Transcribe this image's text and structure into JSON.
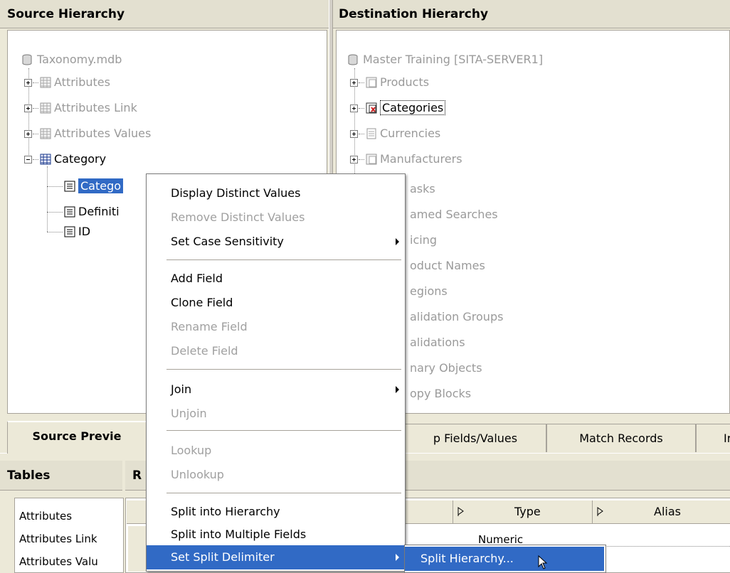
{
  "source": {
    "header": "Source Hierarchy",
    "tree": {
      "root": "Taxonomy.mdb",
      "items": [
        "Attributes",
        "Attributes Link",
        "Attributes Values",
        "Category"
      ],
      "category_children": [
        "Catego",
        "Definiti",
        "ID"
      ]
    }
  },
  "destination": {
    "header": "Destination Hierarchy",
    "tree": {
      "root": "Master Training [SITA-SERVER1]",
      "items": [
        "Products",
        "Categories",
        "Currencies",
        "Manufacturers"
      ],
      "partial_items": [
        "asks",
        "amed Searches",
        "icing",
        "oduct Names",
        "egions",
        "alidation Groups",
        "alidations",
        "nary Objects",
        "opy Blocks"
      ]
    }
  },
  "tabs": {
    "source_preview": "Source Previe",
    "map_fields": "p Fields/Values",
    "match_records": "Match Records",
    "more": "Ir"
  },
  "bottom": {
    "tables_header": "Tables",
    "right_header_partial": "R",
    "tables": [
      "Attributes",
      "Attributes Link",
      "Attributes Valu"
    ],
    "columns": {
      "type": "Type",
      "alias": "Alias"
    },
    "type_value": "Numeric"
  },
  "context_menu": {
    "items": [
      {
        "label": "Display Distinct Values",
        "enabled": true
      },
      {
        "label": "Remove Distinct Values",
        "enabled": false
      },
      {
        "label": "Set Case Sensitivity",
        "enabled": true,
        "submenu": true
      },
      {
        "label": "Add Field",
        "enabled": true
      },
      {
        "label": "Clone Field",
        "enabled": true
      },
      {
        "label": "Rename Field",
        "enabled": false
      },
      {
        "label": "Delete Field",
        "enabled": false
      },
      {
        "label": "Join",
        "enabled": true,
        "submenu": true
      },
      {
        "label": "Unjoin",
        "enabled": false
      },
      {
        "label": "Lookup",
        "enabled": false
      },
      {
        "label": "Unlookup",
        "enabled": false
      },
      {
        "label": "Split into Hierarchy",
        "enabled": true
      },
      {
        "label": "Split into Multiple Fields",
        "enabled": true
      },
      {
        "label": "Set Split Delimiter",
        "enabled": true,
        "submenu": true,
        "highlighted": true
      }
    ],
    "submenu_item": "Split Hierarchy..."
  },
  "colors": {
    "highlight": "#316ac5",
    "panel_bg": "#ece9d8",
    "disabled_text": "#a0a0a0"
  }
}
